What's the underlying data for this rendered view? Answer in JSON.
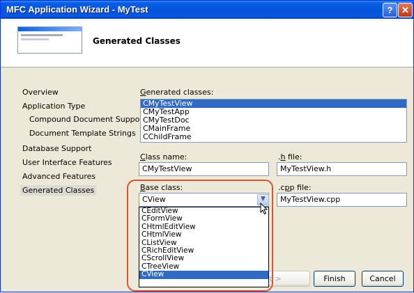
{
  "window": {
    "title": "MFC Application Wizard - MyTest",
    "help_glyph": "?",
    "close_glyph": "✕"
  },
  "header": {
    "title": "Generated Classes"
  },
  "nav": {
    "items": [
      {
        "label": "Overview"
      },
      {
        "label": "Application Type"
      },
      {
        "label": "Compound Document Support"
      },
      {
        "label": "Document Template Strings"
      },
      {
        "label": "Database Support"
      },
      {
        "label": "User Interface Features"
      },
      {
        "label": "Advanced Features"
      },
      {
        "label": "Generated Classes",
        "selected": true
      }
    ]
  },
  "generated_classes": {
    "label_first": "G",
    "label_rest": "enerated classes:",
    "items": [
      "CMyTestView",
      "CMyTestApp",
      "CMyTestDoc",
      "CMainFrame",
      "CChildFrame"
    ],
    "selected": "CMyTestView"
  },
  "class_name": {
    "label_first": "C",
    "label_rest": "lass name:",
    "value": "CMyTestView"
  },
  "h_file": {
    "label_pre": ".",
    "label_first": "h",
    "label_rest": " file:",
    "value": "MyTestView.h"
  },
  "base_class": {
    "label_first": "B",
    "label_rest": "ase class:",
    "value": "CView",
    "options": [
      "CEditView",
      "CFormView",
      "CHtmlEditView",
      "CHtmlView",
      "CListView",
      "CRichEditView",
      "CScrollView",
      "CTreeView",
      "CView"
    ],
    "selected": "CView",
    "arrow_glyph": "▼"
  },
  "cpp_file": {
    "label_pre": ".c",
    "label_first": "p",
    "label_rest": "p file:",
    "value": "MyTestView.cpp"
  },
  "buttons": {
    "next_label": "xt >",
    "finish_label": "Finish",
    "cancel_label": "Cancel"
  },
  "colors": {
    "title_bar": "#0453dc",
    "selection": "#316ac5",
    "highlight_ring": "#e2522a"
  }
}
